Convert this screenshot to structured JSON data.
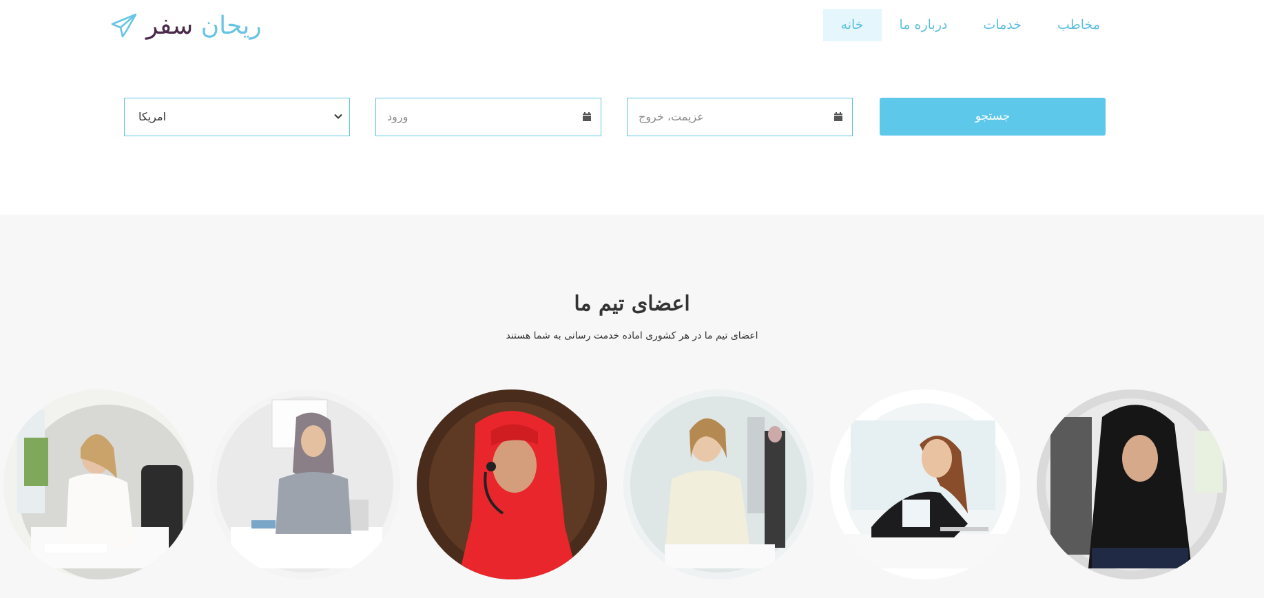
{
  "header": {
    "logo": {
      "word1": "ریحان",
      "word2": "سفر",
      "icon": "paper-plane-icon"
    },
    "nav": [
      {
        "label": "خانه",
        "active": true
      },
      {
        "label": "درباره ما",
        "active": false
      },
      {
        "label": "خدمات",
        "active": false
      },
      {
        "label": "مخاطب",
        "active": false
      }
    ]
  },
  "search": {
    "country_value": "امریکا",
    "checkin_placeholder": "ورود",
    "checkout_placeholder": "عزیمت، خروج",
    "button_label": "جستجو",
    "accent_color": "#5ec8eb"
  },
  "team": {
    "title": "اعضای تیم ما",
    "subtitle": "اعضای تیم ما در  هر کشوری اماده خدمت رسانی به شما هستند",
    "members": [
      {
        "photo": "woman-on-phone-at-desk"
      },
      {
        "photo": "woman-in-hijab-writing-at-desk"
      },
      {
        "photo": "woman-in-red-hijab-with-headset"
      },
      {
        "photo": "businesswoman-in-office"
      },
      {
        "photo": "woman-on-phone-writing"
      },
      {
        "photo": "woman-in-black-hijab-at-desk"
      }
    ]
  }
}
